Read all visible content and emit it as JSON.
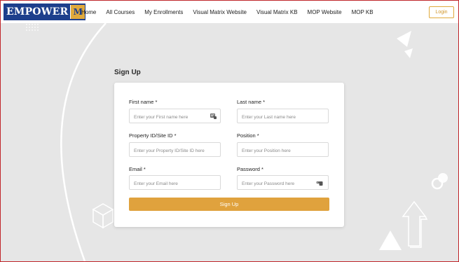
{
  "nav": {
    "logo_text": "EMPOWER",
    "logo_badge": "M",
    "items": [
      {
        "label": "Home"
      },
      {
        "label": "All Courses"
      },
      {
        "label": "My Enrollments"
      },
      {
        "label": "Visual Matrix Website"
      },
      {
        "label": "Visual Matrix KB"
      },
      {
        "label": "MOP Website"
      },
      {
        "label": "MOP KB"
      }
    ],
    "login_label": "Login"
  },
  "page": {
    "heading": "Sign Up"
  },
  "form": {
    "first_name": {
      "label": "First name *",
      "placeholder": "Enter your First name here",
      "icon": "contact-card-icon"
    },
    "last_name": {
      "label": "Last name *",
      "placeholder": "Enter your Last name here"
    },
    "property_id": {
      "label": "Property ID/Site ID *",
      "placeholder": "Enter your Property ID/Site ID here"
    },
    "position": {
      "label": "Position *",
      "placeholder": "Enter your Position here"
    },
    "email": {
      "label": "Email *",
      "placeholder": "Enter your Email here"
    },
    "password": {
      "label": "Password *",
      "placeholder": "Enter your Password here",
      "icon": "password-manager-icon"
    },
    "submit_label": "Sign Up"
  },
  "colors": {
    "accent": "#e0a23d",
    "logo_blue": "#1d3f8c",
    "frame_border": "#c0262b",
    "background": "#e6e6e6"
  }
}
